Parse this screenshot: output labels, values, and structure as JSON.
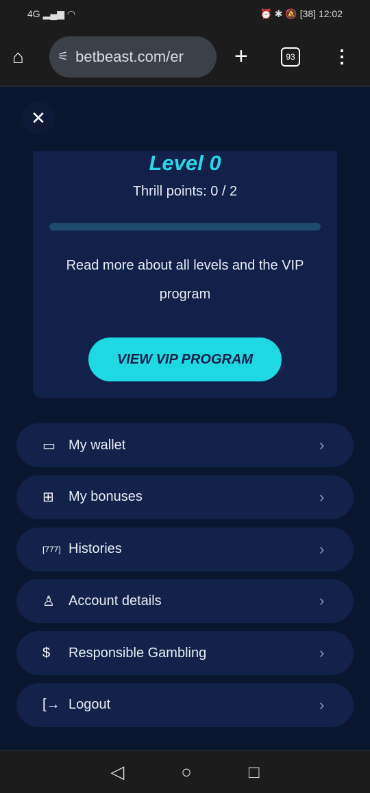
{
  "status": {
    "network": "4G",
    "battery": "38",
    "time": "12:02"
  },
  "browser": {
    "url": "betbeast.com/er",
    "tab_count": "93"
  },
  "vip": {
    "level": "Level 0",
    "thrill_points": "Thrill points: 0 / 2",
    "progress_fraction": 0,
    "description": "Read more about all levels and the VIP program",
    "button": "VIEW VIP PROGRAM"
  },
  "menu": [
    {
      "label": "My wallet",
      "icon": "wallet-icon"
    },
    {
      "label": "My bonuses",
      "icon": "gift-icon"
    },
    {
      "label": "Histories",
      "icon": "slot-machine-icon"
    },
    {
      "label": "Account details",
      "icon": "user-icon"
    },
    {
      "label": "Responsible Gambling",
      "icon": "hand-dollar-icon"
    },
    {
      "label": "Logout",
      "icon": "logout-icon"
    }
  ],
  "colors": {
    "accent": "#1ed8e2",
    "background": "#0b1631",
    "card": "#12214a"
  }
}
